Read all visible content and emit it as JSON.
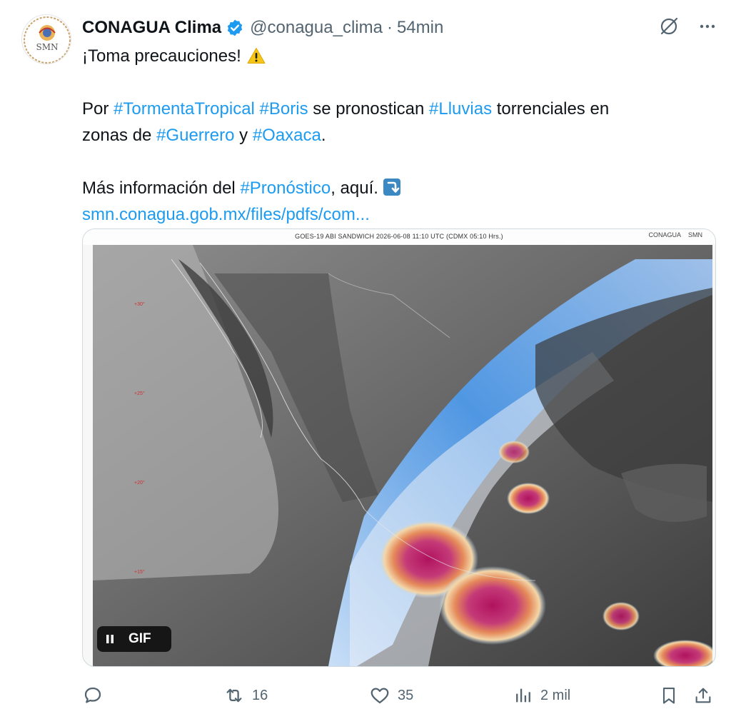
{
  "tweet": {
    "author_name": "CONAGUA Clima",
    "handle": "@conagua_clima",
    "separator": "·",
    "time": "54min",
    "avatar_text": "SMN",
    "line1": "¡Toma precauciones!",
    "line2_a": "Por ",
    "tag_tormenta": "#TormentaTropical",
    "space1": " ",
    "tag_boris": "#Boris",
    "line2_b": " se pronostican ",
    "tag_lluvias": "#Lluvias",
    "line2_c": " torrenciales en",
    "line3_a": "zonas de ",
    "tag_guerrero": "#Guerrero",
    "line3_b": " y ",
    "tag_oaxaca": "#Oaxaca",
    "line3_c": ".",
    "line4_a": "Más información del ",
    "tag_pronostico": "#Pronóstico",
    "line4_b": ", aquí.",
    "link": "smn.conagua.gob.mx/files/pdfs/com..."
  },
  "media": {
    "caption": "GOES-19 ABI SANDWICH 2026-06-08 11:10 UTC (CDMX  05:10 Hrs.)",
    "logo1": "CONAGUA",
    "logo2": "SMN",
    "gif_label": "GIF",
    "lat_labels": [
      "+30°",
      "+25°",
      "+20°",
      "+15°"
    ]
  },
  "actions": {
    "reply_count": "",
    "retweet_count": "16",
    "like_count": "35",
    "views_count": "2 mil"
  },
  "icons": {
    "verified": "verified-badge-icon",
    "grok": "grok-icon",
    "more": "more-icon",
    "warning": "warning-emoji",
    "arrow": "right-arrow-curving-down-emoji",
    "pause": "pause-icon",
    "reply": "reply-icon",
    "retweet": "retweet-icon",
    "like": "heart-icon",
    "views": "views-icon",
    "bookmark": "bookmark-icon",
    "share": "share-icon"
  },
  "colors": {
    "link": "#1d9bf0",
    "muted": "#536471",
    "text": "#0f1419"
  }
}
